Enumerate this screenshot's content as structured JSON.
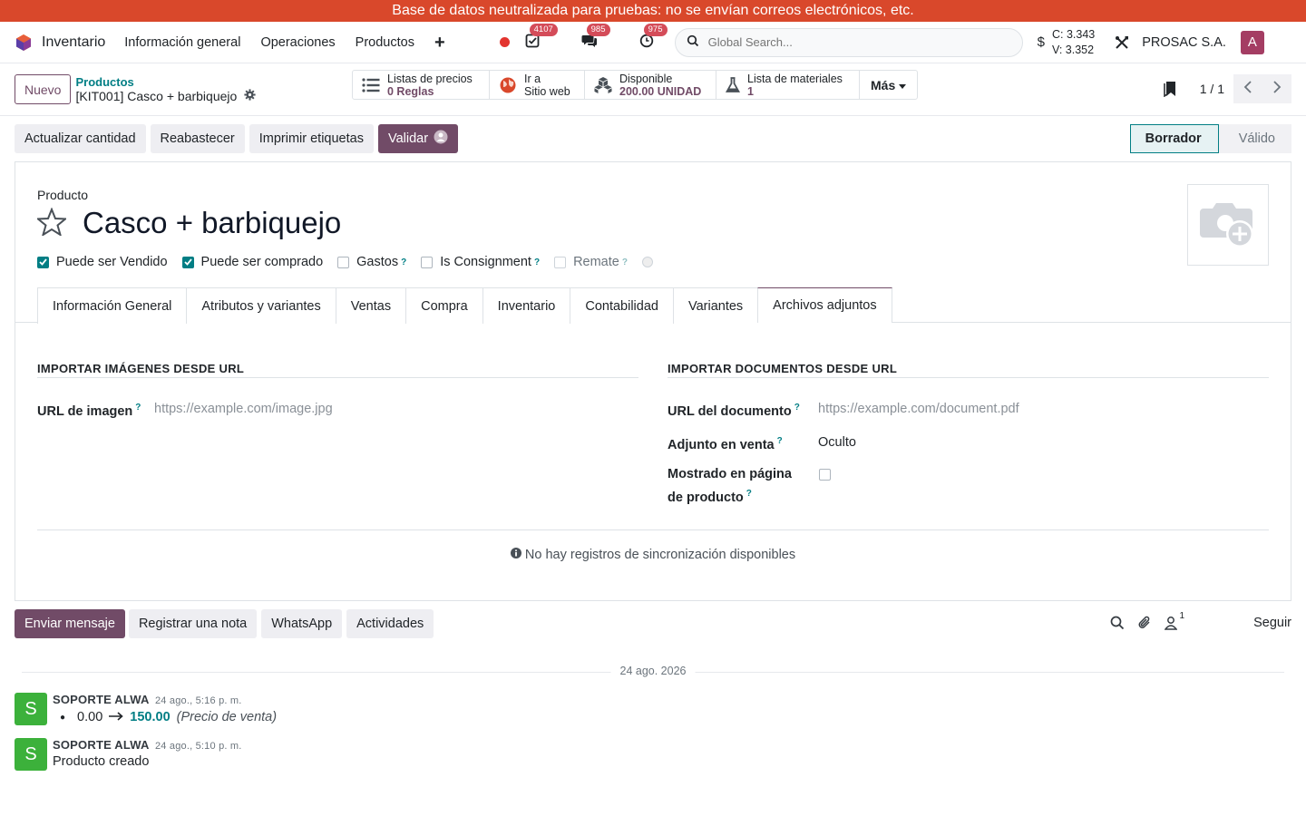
{
  "banner": {
    "text": "Base de datos neutralizada para pruebas: no se envían correos electrónicos, etc."
  },
  "navbar": {
    "app_name": "Inventario",
    "menus": [
      "Información general",
      "Operaciones",
      "Productos"
    ],
    "plus": "+",
    "badges": {
      "activities": "4107",
      "messages": "985",
      "clock": "975"
    },
    "search_placeholder": "Global Search...",
    "cv": {
      "c": "C: 3.343",
      "v": "V: 3.352",
      "symbol": "$"
    },
    "company": "PROSAC S.A.",
    "avatar": "A"
  },
  "control": {
    "new_label": "Nuevo",
    "breadcrumb_parent": "Productos",
    "breadcrumb_current": "[KIT001] Casco + barbiquejo",
    "smart_buttons": [
      {
        "label": "Listas de precios",
        "value": "0 Reglas",
        "icon": "list-icon"
      },
      {
        "label": "Ir a",
        "value": "Sitio web",
        "icon": "globe-icon"
      },
      {
        "label": "Disponible",
        "value": "200.00 UNIDAD",
        "icon": "cubes-icon"
      },
      {
        "label": "Lista de materiales",
        "value": "1",
        "icon": "flask-icon"
      }
    ],
    "more_label": "Más",
    "pager": "1 / 1"
  },
  "statusbar": {
    "buttons": [
      "Actualizar cantidad",
      "Reabastecer",
      "Imprimir etiquetas"
    ],
    "primary": "Validar",
    "stages": {
      "active": "Borrador",
      "inactive": "Válido"
    }
  },
  "form": {
    "product_label": "Producto",
    "product_name": "Casco + barbiquejo",
    "checks": [
      {
        "label": "Puede ser Vendido",
        "checked": true,
        "help": false
      },
      {
        "label": "Puede ser comprado",
        "checked": true,
        "help": false
      },
      {
        "label": "Gastos",
        "checked": false,
        "help": true
      },
      {
        "label": "Is Consignment",
        "checked": false,
        "help": true
      },
      {
        "label": "Remate",
        "checked": false,
        "help": true,
        "muted": true
      }
    ],
    "help_mark": "?",
    "tabs": [
      "Información General",
      "Atributos y variantes",
      "Ventas",
      "Compra",
      "Inventario",
      "Contabilidad",
      "Variantes",
      "Archivos adjuntos"
    ],
    "active_tab": "Archivos adjuntos",
    "left_section": {
      "title": "IMPORTAR IMÁGENES DESDE URL",
      "image_url_label": "URL de imagen",
      "image_url_placeholder": "https://example.com/image.jpg"
    },
    "right_section": {
      "title": "IMPORTAR DOCUMENTOS DESDE URL",
      "doc_url_label": "URL del documento",
      "doc_url_placeholder": "https://example.com/document.pdf",
      "sale_attach_label": "Adjunto en venta",
      "sale_attach_value": "Oculto",
      "shown_label_1": "Mostrado en página",
      "shown_label_2": "de producto"
    },
    "no_sync": "No hay registros de sincronización disponibles"
  },
  "chatter": {
    "send_message": "Enviar mensaje",
    "log_note": "Registrar una nota",
    "whatsapp": "WhatsApp",
    "activities": "Actividades",
    "followers_count": "1",
    "follow": "Seguir",
    "date_separator": "24 ago. 2026",
    "messages": [
      {
        "avatar": "S",
        "author": "SOPORTE ALWA",
        "date": "24 ago., 5:16 p. m.",
        "old_value": "0.00",
        "new_value": "150.00",
        "field": "(Precio de venta)"
      },
      {
        "avatar": "S",
        "author": "SOPORTE ALWA",
        "date": "24 ago., 5:10 p. m.",
        "text": "Producto creado"
      }
    ]
  },
  "colors": {
    "primary": "#714b67",
    "accent": "#017e84",
    "banner": "#d9482b",
    "avatar_green": "#3cb13b"
  }
}
